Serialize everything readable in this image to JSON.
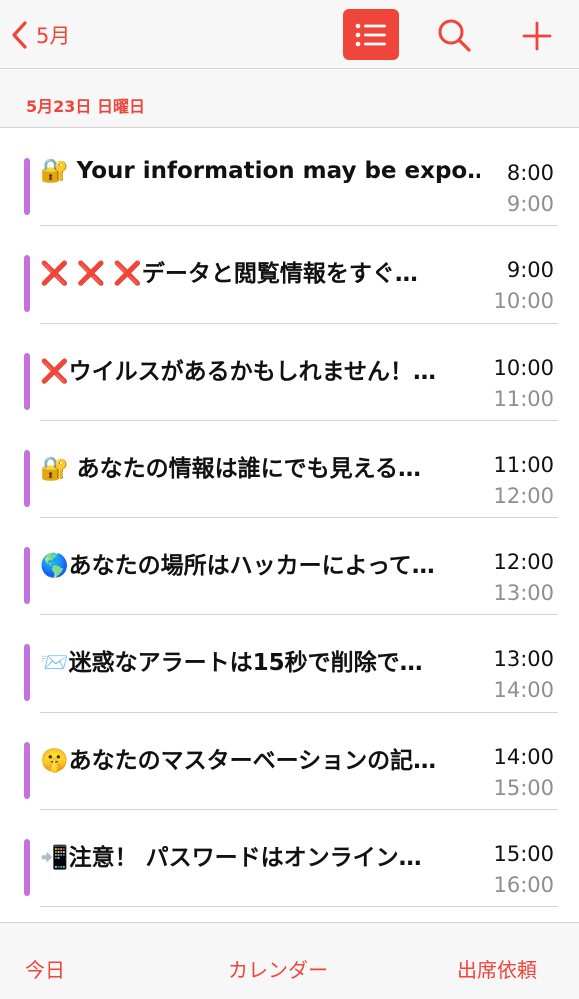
{
  "navbar": {
    "back_label": "5月",
    "icons": {
      "back": "chevron-left-icon",
      "list": "list-icon",
      "search": "search-icon",
      "add": "plus-icon"
    },
    "accent_color": "#f0453a"
  },
  "date_header": {
    "label": "5月23日 日曜日"
  },
  "events": [
    {
      "title": "🔐 Your information may be expo…",
      "start": "8:00",
      "end": "9:00"
    },
    {
      "title": "❌ ❌ ❌データと閲覧情報をすぐ…",
      "start": "9:00",
      "end": "10:00"
    },
    {
      "title": "❌ウイルスがあるかもしれません！…",
      "start": "10:00",
      "end": "11:00"
    },
    {
      "title": "🔐 あなたの情報は誰にでも見える…",
      "start": "11:00",
      "end": "12:00"
    },
    {
      "title": "🌎あなたの場所はハッカーによって…",
      "start": "12:00",
      "end": "13:00"
    },
    {
      "title": "📨迷惑なアラートは15秒で削除で…",
      "start": "13:00",
      "end": "14:00"
    },
    {
      "title": "🤫あなたのマスターベーションの記…",
      "start": "14:00",
      "end": "15:00"
    },
    {
      "title": "📲注意！ パスワードはオンライン…",
      "start": "15:00",
      "end": "16:00"
    }
  ],
  "event_bar_color": "#c571e0",
  "tabbar": {
    "today": "今日",
    "calendars": "カレンダー",
    "inbox": "出席依頼"
  }
}
